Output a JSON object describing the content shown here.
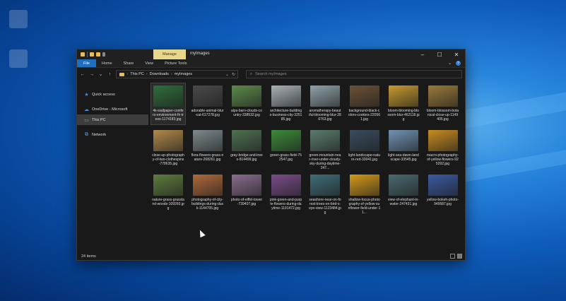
{
  "window": {
    "context_tab": "Manage",
    "title": "myImages",
    "controls": [
      "–",
      "☐",
      "✕"
    ]
  },
  "ribbon": {
    "tabs": [
      "File",
      "Home",
      "Share",
      "View",
      "Picture Tools"
    ],
    "expand_glyph": "⌄",
    "help_glyph": "?"
  },
  "nav": {
    "back": "←",
    "forward": "→",
    "history": "⌄",
    "up": "↑"
  },
  "address": {
    "crumbs": [
      "This PC",
      "Downloads",
      "myImages"
    ],
    "separator": "›",
    "dropdown": "⌄",
    "refresh": "↻"
  },
  "search": {
    "icon": "⌕",
    "placeholder": "Search myImages"
  },
  "sidebar": {
    "items": [
      {
        "label": "Quick access",
        "icon": "star-icon",
        "glyph": "★",
        "color": "#3f8fe0"
      },
      {
        "label": "OneDrive - Microsoft",
        "icon": "cloud-icon",
        "glyph": "☁",
        "color": "#3f8fe0"
      },
      {
        "label": "This PC",
        "icon": "computer-icon",
        "glyph": "▭",
        "color": "#49a2e6"
      },
      {
        "label": "Network",
        "icon": "network-icon",
        "glyph": "⧉",
        "color": "#5aa0e0"
      }
    ]
  },
  "files": [
    {
      "name": "4k-wallpaper-conifers-environment-fir-trees-1174183.jpg",
      "color": "#2f6e3b",
      "selected": true
    },
    {
      "name": "adorable-animal-blur-cat-617278.jpg",
      "color": "#4a4a4a"
    },
    {
      "name": "alps-barn-clouds-country-338532.jpg",
      "color": "#5d8a4a"
    },
    {
      "name": "architecture-buildings-business-city-325185.jpg",
      "color": "#a9b2b8"
    },
    {
      "name": "aromatherapy-beautiful-blooming-blur-286763.jpg",
      "color": "#8fa3a8"
    },
    {
      "name": "background-black-colors-cookies-220561.jpg",
      "color": "#6b5236"
    },
    {
      "name": "bloom-blooming-blossom-blur-462118.jpg",
      "color": "#c69a2e"
    },
    {
      "name": "bloom-blossom-botanical-close-up-1149405.jpg",
      "color": "#9a7a3a"
    },
    {
      "name": "close-up-photography-of-two-clothespins-778635.jpg",
      "color": "#b2894a"
    },
    {
      "name": "flora-flowers-grass-nature-268261.jpg",
      "color": "#7d8a8e"
    },
    {
      "name": "gray-bridge-and-trees-814499.jpg",
      "color": "#4f7150"
    },
    {
      "name": "green-grass-field-752547.jpg",
      "color": "#3d8a3a"
    },
    {
      "name": "green-mountain-near-river-under-cloudy-sky-during-daytime-247...",
      "color": "#5b7c6d"
    },
    {
      "name": "light-landscape-nature-red-33041.jpg",
      "color": "#3a4c5e"
    },
    {
      "name": "light-sea-dawn-landscape-33545.jpg",
      "color": "#7092b2"
    },
    {
      "name": "macro-photography-of-yellow-flowers-925392.jpg",
      "color": "#c88c1e"
    },
    {
      "name": "nature-grass-grassland-woods-109260.jpg",
      "color": "#5e7d3e"
    },
    {
      "name": "photography-of-city-buildings-during-dusk-1144705.jpg",
      "color": "#b06a3a"
    },
    {
      "name": "photo-of-eiffel-tower-739407.jpg",
      "color": "#8a6e8e"
    },
    {
      "name": "pink-green-and-purple-flowers-during-daytime-1191472.jpg",
      "color": "#7a4d8a"
    },
    {
      "name": "seashore-near-on-forest-trees-on-bird-s-eye-view-1123484.jpg",
      "color": "#3e6e78"
    },
    {
      "name": "shallow-focus-photography-of-yellow-sunflower-field-under-11...",
      "color": "#d49a1a"
    },
    {
      "name": "view-of-elephant-in-water-247431.jpg",
      "color": "#4a6a70"
    },
    {
      "name": "yellow-bokeh-photo-949587.jpg",
      "color": "#3a5aa2"
    }
  ],
  "status": {
    "count": "24 items"
  },
  "colors": {
    "explorer_bg": "#191919",
    "accent": "#1f6fc0",
    "context_tab": "#e8d68a",
    "folder": "#e8bd56"
  }
}
